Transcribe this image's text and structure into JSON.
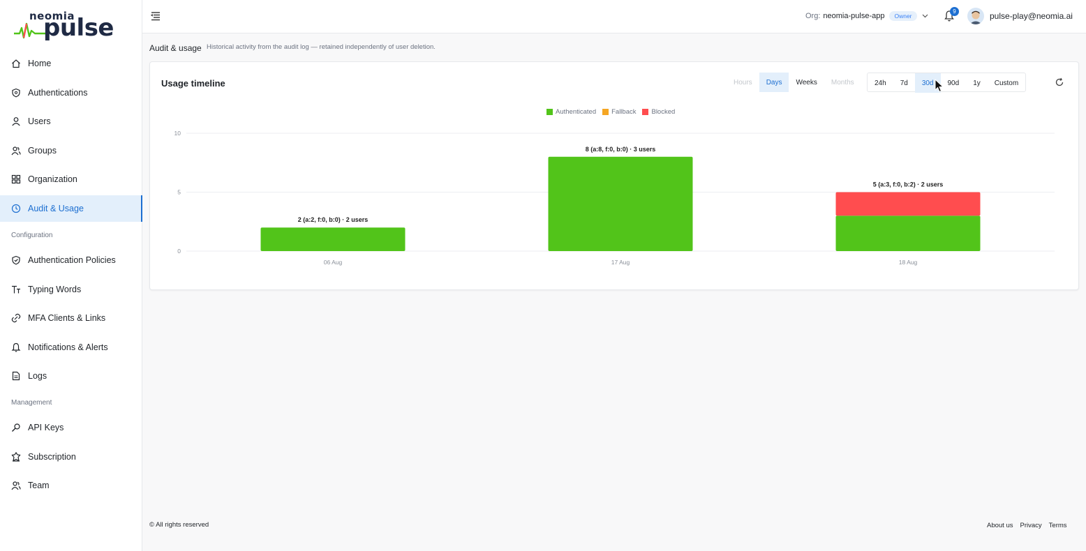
{
  "app": {
    "brand_small": "neomia",
    "brand_big": "pulse"
  },
  "sidebar": {
    "items": [
      {
        "label": "Home",
        "icon": "home-icon"
      },
      {
        "label": "Authentications",
        "icon": "shield-icon"
      },
      {
        "label": "Users",
        "icon": "user-icon"
      },
      {
        "label": "Groups",
        "icon": "users-icon"
      },
      {
        "label": "Organization",
        "icon": "grid-icon"
      },
      {
        "label": "Audit & Usage",
        "icon": "clock-icon",
        "active": true
      }
    ],
    "config_section": "Configuration",
    "config_items": [
      {
        "label": "Authentication Policies",
        "icon": "shield-check-icon"
      },
      {
        "label": "Typing Words",
        "icon": "text-icon"
      },
      {
        "label": "MFA Clients & Links",
        "icon": "link-icon"
      },
      {
        "label": "Notifications & Alerts",
        "icon": "bell-icon"
      },
      {
        "label": "Logs",
        "icon": "file-icon"
      }
    ],
    "management_section": "Management",
    "management_items": [
      {
        "label": "API Keys",
        "icon": "key-icon"
      },
      {
        "label": "Subscription",
        "icon": "badge-icon"
      },
      {
        "label": "Team",
        "icon": "team-icon"
      }
    ]
  },
  "topbar": {
    "org_label": "Org:",
    "org_name": "neomia-pulse-app",
    "role": "Owner",
    "notification_count": "9",
    "user_email": "pulse-play@neomia.ai"
  },
  "page": {
    "title": "Audit & usage",
    "subtitle": "Historical activity from the audit log — retained independently of user deletion."
  },
  "card": {
    "title": "Usage timeline",
    "granularity": [
      "Hours",
      "Days",
      "Weeks",
      "Months"
    ],
    "granularity_selected": "Days",
    "granularity_disabled": [
      "Hours",
      "Months"
    ],
    "ranges": [
      "24h",
      "7d",
      "30d",
      "90d",
      "1y",
      "Custom"
    ],
    "range_selected": "30d"
  },
  "colors": {
    "authenticated": "#52c41a",
    "fallback": "#f5a623",
    "blocked": "#ff4d4f",
    "accent": "#1d6fd1"
  },
  "chart_data": {
    "type": "bar",
    "stacked": true,
    "categories": [
      "06 Aug",
      "17 Aug",
      "18 Aug"
    ],
    "series": [
      {
        "name": "Authenticated",
        "values": [
          2,
          8,
          3
        ]
      },
      {
        "name": "Fallback",
        "values": [
          0,
          0,
          0
        ]
      },
      {
        "name": "Blocked",
        "values": [
          0,
          0,
          2
        ]
      }
    ],
    "bar_labels": [
      "2 (a:2, f:0, b:0) · 2 users",
      "8 (a:8, f:0, b:0) · 3 users",
      "5 (a:3, f:0, b:2) · 2 users"
    ],
    "yticks": [
      0,
      5,
      10
    ],
    "ylim": [
      0,
      10
    ],
    "legend_position": "top-center",
    "grid": true
  },
  "footer": {
    "copyright": "© All rights reserved",
    "links": [
      "About us",
      "Privacy",
      "Terms"
    ]
  }
}
